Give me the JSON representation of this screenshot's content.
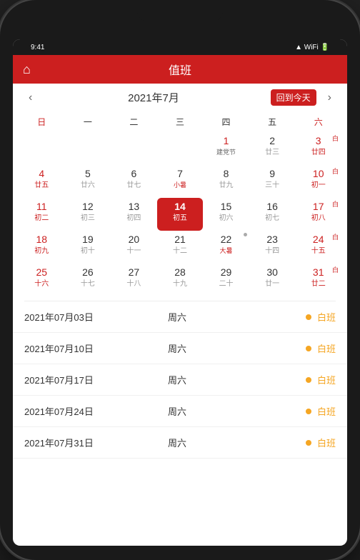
{
  "app": {
    "title": "值班",
    "home_icon": "🏠"
  },
  "header": {
    "title": "值班",
    "today_btn": "回到今天"
  },
  "calendar": {
    "month": "2021年7月",
    "weekdays": [
      "日",
      "一",
      "二",
      "三",
      "四",
      "五",
      "六"
    ],
    "nav_prev": "‹",
    "nav_next": "›",
    "weeks": [
      [
        {
          "num": "",
          "sub": "",
          "type": "empty"
        },
        {
          "num": "",
          "sub": "",
          "type": "empty"
        },
        {
          "num": "",
          "sub": "",
          "type": "empty"
        },
        {
          "num": "",
          "sub": "",
          "type": "empty"
        },
        {
          "num": "1",
          "sub": "建党节",
          "type": "festival",
          "col": "thu"
        },
        {
          "num": "2",
          "sub": "廿三",
          "type": "normal",
          "col": "fri"
        },
        {
          "num": "3",
          "sub": "廿四",
          "type": "saturday",
          "badge": "白"
        }
      ],
      [
        {
          "num": "4",
          "sub": "廿五",
          "type": "sunday"
        },
        {
          "num": "5",
          "sub": "廿六",
          "type": "normal"
        },
        {
          "num": "6",
          "sub": "廿七",
          "type": "normal"
        },
        {
          "num": "7",
          "sub": "小暑",
          "type": "normal",
          "col": "term"
        },
        {
          "num": "8",
          "sub": "廿九",
          "type": "normal"
        },
        {
          "num": "9",
          "sub": "三十",
          "type": "normal"
        },
        {
          "num": "10",
          "sub": "初一",
          "type": "saturday",
          "badge": "白"
        }
      ],
      [
        {
          "num": "11",
          "sub": "初二",
          "type": "sunday"
        },
        {
          "num": "12",
          "sub": "初三",
          "type": "normal"
        },
        {
          "num": "13",
          "sub": "初四",
          "type": "normal"
        },
        {
          "num": "14",
          "sub": "初五",
          "type": "today"
        },
        {
          "num": "15",
          "sub": "初六",
          "type": "normal"
        },
        {
          "num": "16",
          "sub": "初七",
          "type": "normal"
        },
        {
          "num": "17",
          "sub": "初八",
          "type": "saturday",
          "badge": "白"
        }
      ],
      [
        {
          "num": "18",
          "sub": "初九",
          "type": "sunday"
        },
        {
          "num": "19",
          "sub": "初十",
          "type": "normal"
        },
        {
          "num": "20",
          "sub": "十一",
          "type": "normal"
        },
        {
          "num": "21",
          "sub": "十二",
          "type": "normal"
        },
        {
          "num": "22",
          "sub": "大暑",
          "type": "normal",
          "col": "term",
          "dot": true
        },
        {
          "num": "23",
          "sub": "十四",
          "type": "normal"
        },
        {
          "num": "24",
          "sub": "十五",
          "type": "saturday",
          "badge": "白"
        }
      ],
      [
        {
          "num": "25",
          "sub": "十六",
          "type": "sunday"
        },
        {
          "num": "26",
          "sub": "十七",
          "type": "normal"
        },
        {
          "num": "27",
          "sub": "十八",
          "type": "normal"
        },
        {
          "num": "28",
          "sub": "十九",
          "type": "normal"
        },
        {
          "num": "29",
          "sub": "二十",
          "type": "normal"
        },
        {
          "num": "30",
          "sub": "廿一",
          "type": "normal"
        },
        {
          "num": "31",
          "sub": "廿二",
          "type": "saturday",
          "badge": "白"
        }
      ]
    ]
  },
  "schedule": {
    "items": [
      {
        "date": "2021年07月03日",
        "weekday": "周六",
        "dot_color": "#f5a623",
        "type": "白班"
      },
      {
        "date": "2021年07月10日",
        "weekday": "周六",
        "dot_color": "#f5a623",
        "type": "白班"
      },
      {
        "date": "2021年07月17日",
        "weekday": "周六",
        "dot_color": "#f5a623",
        "type": "白班"
      },
      {
        "date": "2021年07月24日",
        "weekday": "周六",
        "dot_color": "#f5a623",
        "type": "白班"
      },
      {
        "date": "2021年07月31日",
        "weekday": "周六",
        "dot_color": "#f5a623",
        "type": "白班"
      }
    ]
  }
}
